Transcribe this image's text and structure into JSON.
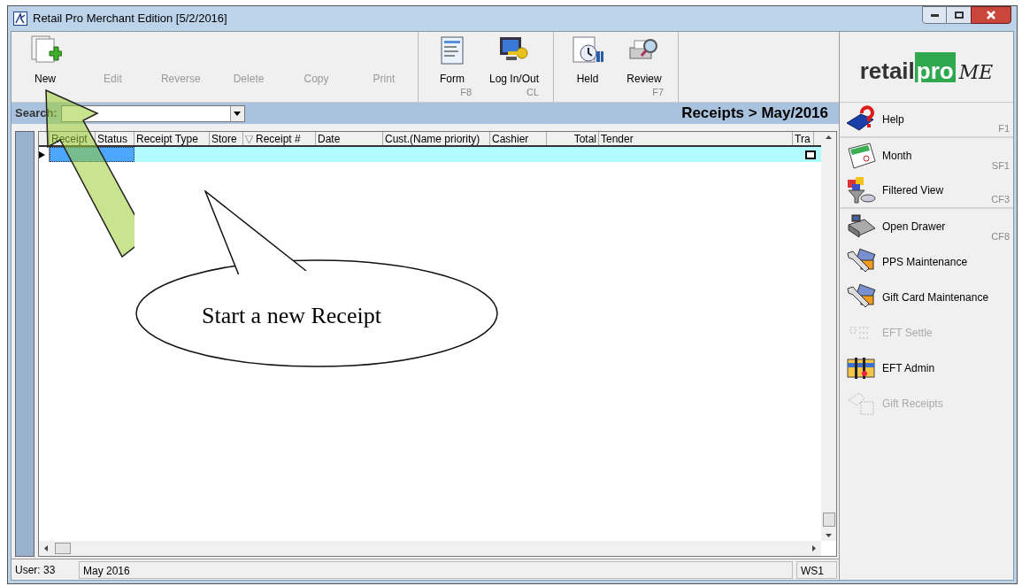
{
  "window": {
    "title": "Retail Pro Merchant Edition [5/2/2016]"
  },
  "toolbar": {
    "groups": [
      {
        "buttons": [
          {
            "label": "New",
            "disabled": false
          },
          {
            "label": "Edit",
            "disabled": true
          },
          {
            "label": "Reverse",
            "disabled": true
          },
          {
            "label": "Delete",
            "disabled": true
          },
          {
            "label": "Copy",
            "disabled": true
          },
          {
            "label": "Print",
            "disabled": true
          }
        ]
      },
      {
        "buttons": [
          {
            "label": "Form",
            "disabled": false,
            "shortcut": "F8"
          },
          {
            "label": "Log In/Out",
            "disabled": false,
            "shortcut": "CL"
          }
        ]
      },
      {
        "buttons": [
          {
            "label": "Held",
            "disabled": false
          },
          {
            "label": "Review",
            "disabled": false,
            "shortcut": "F7"
          }
        ]
      }
    ]
  },
  "logo": {
    "word": "retail",
    "badge": "pro",
    "suffix": "ME"
  },
  "search": {
    "label": "Search:"
  },
  "breadcrumb": "Receipts > May/2016",
  "table": {
    "columns": [
      {
        "label": "Receipt",
        "sorted": false
      },
      {
        "label": "Status",
        "sorted": false
      },
      {
        "label": "Receipt Type",
        "sorted": false
      },
      {
        "label": "Store",
        "sorted": false
      },
      {
        "label": "Receipt #",
        "sorted": true
      },
      {
        "label": "Date",
        "sorted": false
      },
      {
        "label": "Cust.(Name priority)",
        "sorted": false
      },
      {
        "label": "Cashier",
        "sorted": false
      },
      {
        "label": "Total",
        "sorted": false
      },
      {
        "label": "Tender",
        "sorted": false
      },
      {
        "label": "Tra",
        "sorted": false
      }
    ],
    "rows": [
      {
        "selected": true,
        "checked": false
      }
    ]
  },
  "side_panel": [
    {
      "label": "Help",
      "shortcut": "F1",
      "disabled": false,
      "divider": true
    },
    {
      "label": "Month",
      "shortcut": "SF1",
      "disabled": false,
      "divider": false
    },
    {
      "label": "Filtered View",
      "shortcut": "CF3",
      "disabled": false,
      "divider": true
    },
    {
      "label": "Open Drawer",
      "shortcut": "CF8",
      "disabled": false,
      "divider": false
    },
    {
      "label": "PPS Maintenance",
      "disabled": false,
      "divider": false
    },
    {
      "label": "Gift Card Maintenance",
      "disabled": false,
      "divider": false
    },
    {
      "label": "EFT Settle",
      "disabled": true,
      "divider": false
    },
    {
      "label": "EFT Admin",
      "disabled": false,
      "divider": false
    },
    {
      "label": "Gift Receipts",
      "disabled": true,
      "divider": false
    }
  ],
  "status_bar": {
    "user": "User: 33",
    "period": "May 2016",
    "workstation": "WS1"
  },
  "callout": {
    "text": "Start a new Receipt"
  }
}
